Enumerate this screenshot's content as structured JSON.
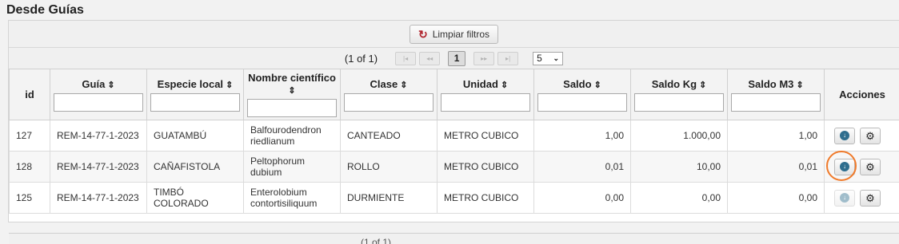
{
  "panel": {
    "title": "Desde Guías"
  },
  "toolbar": {
    "clear_filters_label": "Limpiar filtros",
    "clear_icon": "refresh-icon"
  },
  "paginator": {
    "report": "(1 of 1)",
    "current_page": "1",
    "rows_per_page": "5",
    "first_label": "|◂",
    "prev_label": "◂◂",
    "next_label": "▸▸",
    "last_label": "▸|"
  },
  "columns": [
    {
      "id": "id",
      "label": "id",
      "sortable": false,
      "filter": false
    },
    {
      "id": "guia",
      "label": "Guía",
      "sortable": true,
      "filter": true
    },
    {
      "id": "especie",
      "label": "Especie local",
      "sortable": true,
      "filter": true
    },
    {
      "id": "nombre",
      "label": "Nombre científico",
      "sortable": true,
      "filter": true
    },
    {
      "id": "clase",
      "label": "Clase",
      "sortable": true,
      "filter": true
    },
    {
      "id": "unidad",
      "label": "Unidad",
      "sortable": true,
      "filter": true
    },
    {
      "id": "saldo",
      "label": "Saldo",
      "sortable": true,
      "filter": true
    },
    {
      "id": "saldo_kg",
      "label": "Saldo Kg",
      "sortable": true,
      "filter": true
    },
    {
      "id": "saldo_m3",
      "label": "Saldo M3",
      "sortable": true,
      "filter": true
    },
    {
      "id": "acciones",
      "label": "Acciones",
      "sortable": false,
      "filter": false
    }
  ],
  "rows": [
    {
      "id": "127",
      "guia": "REM-14-77-1-2023",
      "especie": "GUATAMBÚ",
      "nombre": "Balfourodendron riedlianum",
      "clase": "CANTEADO",
      "unidad": "METRO CUBICO",
      "saldo": "1,00",
      "saldo_kg": "1.000,00",
      "saldo_m3": "1,00",
      "download_enabled": true
    },
    {
      "id": "128",
      "guia": "REM-14-77-1-2023",
      "especie": "CAÑAFISTOLA",
      "nombre": "Peltophorum dubium",
      "clase": "ROLLO",
      "unidad": "METRO CUBICO",
      "saldo": "0,01",
      "saldo_kg": "10,00",
      "saldo_m3": "0,01",
      "download_enabled": true
    },
    {
      "id": "125",
      "guia": "REM-14-77-1-2023",
      "especie": "TIMBÓ COLORADO",
      "nombre": "Enterolobium contortisiliquum",
      "clase": "DURMIENTE",
      "unidad": "METRO CUBICO",
      "saldo": "0,00",
      "saldo_kg": "0,00",
      "saldo_m3": "0,00",
      "download_enabled": false
    }
  ],
  "icons": {
    "download": "arrow-down-circle-icon",
    "settings": "gear-icon"
  },
  "colors": {
    "highlight": "#f07a2a",
    "download_icon": "#2f6e8e",
    "refresh_icon": "#b0242d"
  }
}
